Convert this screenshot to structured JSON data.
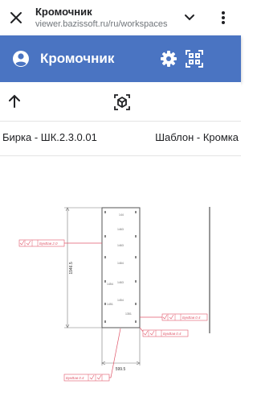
{
  "browser": {
    "page_title": "Кромочник",
    "url": "viewer.bazissoft.ru/ru/workspaces"
  },
  "icons": {
    "close": "close-icon",
    "chevron": "chevron-down-icon",
    "more": "more-vert-icon",
    "user": "account-circle-icon",
    "settings": "gear-icon",
    "qr": "qr-scan-icon",
    "back": "arrow-up-icon",
    "model3d": "3d-cube-icon"
  },
  "appbar": {
    "title": "Кромочник",
    "color": "#4a74c2"
  },
  "info": {
    "tag": "Бирка - ШК.2.3.0.01",
    "template": "Шаблон - Кромка"
  },
  "drawing": {
    "height_dim": "1946.5",
    "width_dim": "599.5",
    "edge_labels": [
      "БукВав 2.0",
      "БукВав 0.4",
      "БукВав 0.4",
      "БукВав 0.4"
    ],
    "marks": [
      "144",
      "1463",
      "1463",
      "1464",
      "1463",
      "1454",
      "1454",
      "1451",
      "1351"
    ],
    "accent_color": "#e0586b"
  }
}
